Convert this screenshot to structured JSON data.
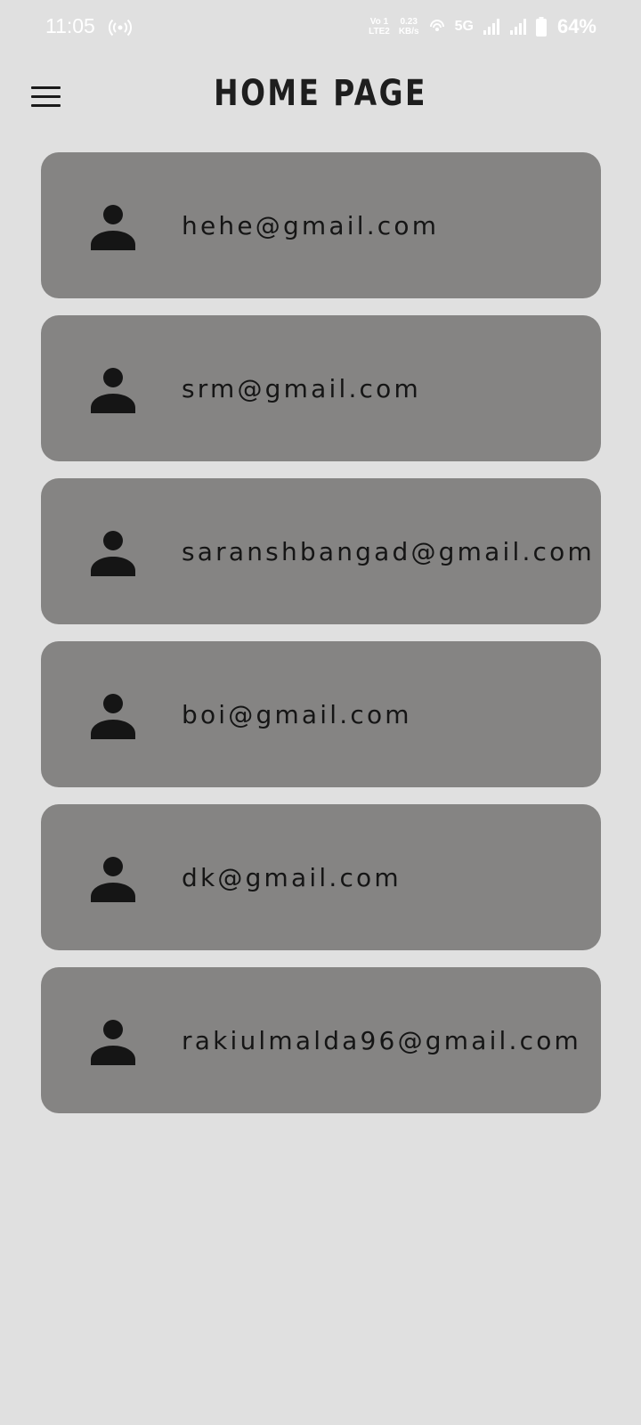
{
  "status_bar": {
    "time": "11:05",
    "volte_top": "Vo 1",
    "volte_bottom": "LTE2",
    "speed_value": "0.23",
    "speed_unit": "KB/s",
    "network": "5G",
    "battery": "64%",
    "icons": [
      "hotspot-icon",
      "wifi-calling-icon",
      "signal-icon",
      "signal-icon",
      "battery-icon"
    ]
  },
  "app_bar": {
    "title": "HOME PAGE",
    "menu_icon": "hamburger-menu-icon"
  },
  "users": [
    {
      "email": "hehe@gmail.com",
      "icon": "person-icon"
    },
    {
      "email": "srm@gmail.com",
      "icon": "person-icon"
    },
    {
      "email": "saranshbangad@gmail.com",
      "icon": "person-icon"
    },
    {
      "email": "boi@gmail.com",
      "icon": "person-icon"
    },
    {
      "email": "dk@gmail.com",
      "icon": "person-icon"
    },
    {
      "email": "rakiulmalda96@gmail.com",
      "icon": "person-icon"
    }
  ],
  "colors": {
    "background": "#e0e0e0",
    "card": "#858483",
    "text": "#151515"
  }
}
